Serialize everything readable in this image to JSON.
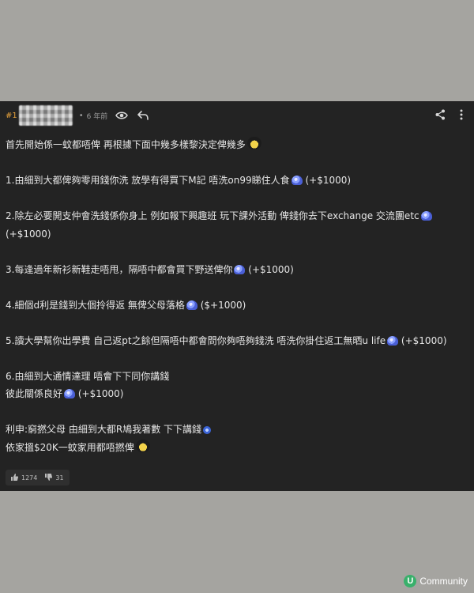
{
  "post": {
    "number": "#1",
    "dot": "•",
    "timestamp": "6 年前",
    "lines": [
      {
        "text": "首先開始係一蚊都唔俾 再根據下面中幾多樣黎決定俾幾多",
        "emoji": "big"
      },
      {
        "text": ""
      },
      {
        "text": "1.由細到大都俾夠零用錢你洗 放學有得買下M記 唔洗on99睇住人食",
        "emoji": "normal",
        "suffix": " (+$1000)"
      },
      {
        "text": ""
      },
      {
        "text": "2.除左必要開支仲會洗錢係你身上 例如報下興趣班 玩下課外活動 俾錢你去下exchange 交流團etc",
        "emoji": "normal"
      },
      {
        "text": "(+$1000)"
      },
      {
        "text": ""
      },
      {
        "text": "3.每逢過年新衫新鞋走唔甩，隔唔中都會買下野送俾你",
        "emoji": "normal",
        "suffix": " (+$1000)"
      },
      {
        "text": ""
      },
      {
        "text": "4.細個d利是錢到大個拎得返 無俾父母落格",
        "emoji": "normal",
        "suffix": " ($+1000)"
      },
      {
        "text": ""
      },
      {
        "text": "5.讀大學幫你出學費 自己返pt之餘但隔唔中都會問你夠唔夠錢洗 唔洗你掛住返工無晒u life",
        "emoji": "normal",
        "suffix": " (+$1000)"
      },
      {
        "text": ""
      },
      {
        "text": "6.由細到大通情達理 唔會下下同你講錢"
      },
      {
        "text": "彼此關係良好",
        "emoji": "normal",
        "suffix": " (+$1000)"
      },
      {
        "text": ""
      },
      {
        "text": "利申:窮撚父母 由細到大都R鳩我著數 下下講錢",
        "emoji": "small"
      },
      {
        "text": "依家搵$20K一蚊家用都唔撚俾",
        "emoji": "big"
      }
    ]
  },
  "votes": {
    "up_count": "1274",
    "down_count": "31"
  },
  "brand": {
    "badge": "U",
    "name": "Community"
  },
  "icons": {
    "header": [
      "eye-icon",
      "reply-icon",
      "share-icon",
      "more-icon"
    ],
    "votes": [
      "thumbs-up-icon",
      "thumbs-down-icon"
    ]
  },
  "colors": {
    "page_background": "#a5a4a0",
    "panel_background": "#232323",
    "post_number": "#e6a23c",
    "text": "#e6e6e6",
    "brand_badge": "#39b06b"
  }
}
